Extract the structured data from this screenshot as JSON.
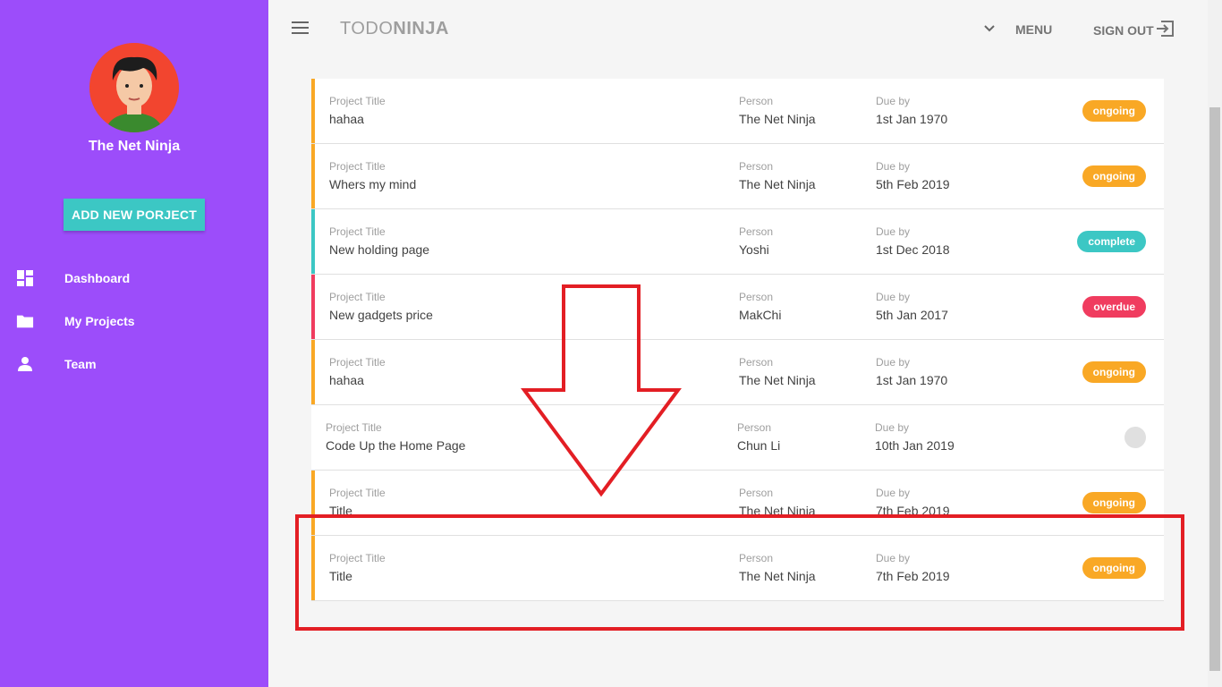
{
  "sidebar": {
    "user_name": "The Net Ninja",
    "add_button_label": "ADD NEW PORJECT",
    "items": [
      {
        "label": "Dashboard",
        "icon": "dashboard-icon"
      },
      {
        "label": "My Projects",
        "icon": "folder-icon"
      },
      {
        "label": "Team",
        "icon": "person-icon"
      }
    ]
  },
  "toolbar": {
    "brand_light": "TODO",
    "brand_bold": "NINJA",
    "menu_label": "MENU",
    "signout_label": "SIGN OUT"
  },
  "labels": {
    "title": "Project Title",
    "person": "Person",
    "due": "Due by"
  },
  "projects": [
    {
      "title": "hahaa",
      "person": "The Net Ninja",
      "due": "1st Jan 1970",
      "status": "ongoing"
    },
    {
      "title": "Whers my mind",
      "person": "The Net Ninja",
      "due": "5th Feb 2019",
      "status": "ongoing"
    },
    {
      "title": "New holding page",
      "person": "Yoshi",
      "due": "1st Dec 2018",
      "status": "complete"
    },
    {
      "title": "New gadgets price",
      "person": "MakChi",
      "due": "5th Jan 2017",
      "status": "overdue"
    },
    {
      "title": "hahaa",
      "person": "The Net Ninja",
      "due": "1st Jan 1970",
      "status": "ongoing"
    },
    {
      "title": "Code Up the Home Page",
      "person": "Chun Li",
      "due": "10th Jan 2019",
      "status": ""
    },
    {
      "title": "Title",
      "person": "The Net Ninja",
      "due": "7th Feb 2019",
      "status": "ongoing"
    },
    {
      "title": "Title",
      "person": "The Net Ninja",
      "due": "7th Feb 2019",
      "status": "ongoing"
    }
  ],
  "colors": {
    "sidebar": "#9c4dfa",
    "accent": "#3cc7c4",
    "ongoing": "#f9a825",
    "complete": "#3cc7c4",
    "overdue": "#f03c5f",
    "annotation": "#e31e24"
  }
}
